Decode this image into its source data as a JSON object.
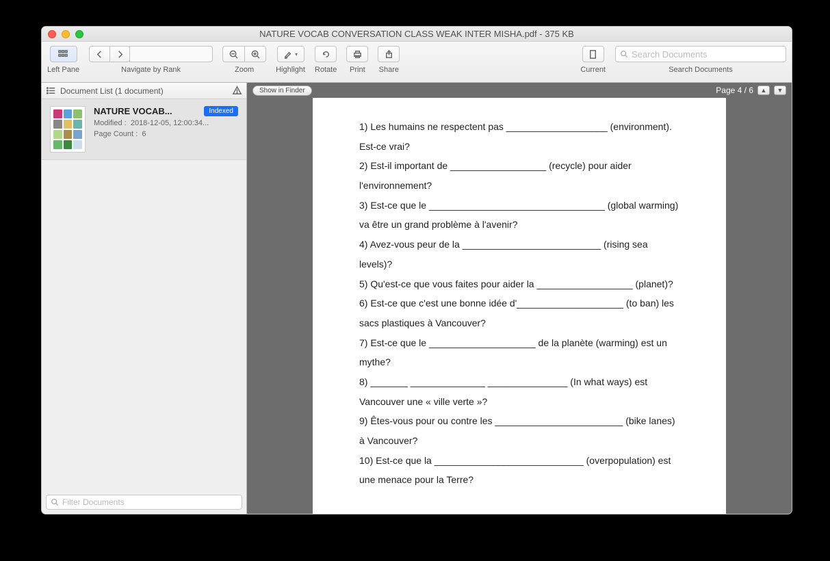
{
  "window": {
    "title": "NATURE VOCAB CONVERSATION CLASS WEAK INTER MISHA.pdf - 375 KB"
  },
  "toolbar": {
    "left_pane": "Left Pane",
    "navigate": "Navigate by Rank",
    "zoom": "Zoom",
    "highlight": "Highlight",
    "rotate": "Rotate",
    "print": "Print",
    "share": "Share",
    "current": "Current",
    "search_label": "Search Documents",
    "search_placeholder": "Search Documents"
  },
  "sidebar": {
    "header": "Document List (1 document)",
    "item": {
      "title": "NATURE VOCAB...",
      "badge": "Indexed",
      "modified_label": "Modified :",
      "modified_value": "2018-12-05, 12:00:34...",
      "page_count_label": "Page Count :",
      "page_count_value": "6"
    },
    "filter_placeholder": "Filter Documents"
  },
  "viewer": {
    "show_in_finder": "Show in Finder",
    "page_indicator": "Page 4 / 6"
  },
  "document": {
    "lines": [
      "1) Les humains ne respectent pas ___________________ (environment). Est-ce vrai?",
      "2) Est-il important de __________________ (recycle) pour aider l'environnement?",
      "3) Est-ce que le _________________________________ (global warming) va être un grand problème à l'avenir?",
      "4) Avez-vous peur de la __________________________ (rising sea levels)?",
      "5) Qu'est-ce que vous faites pour aider la __________________ (planet)?",
      "6) Est-ce que c'est une bonne idée d'____________________ (to ban) les sacs plastiques à Vancouver?",
      "7) Est-ce que le ____________________ de la planète (warming) est un mythe?",
      "8) _______ ______________ _______________ (In what ways) est Vancouver une « ville verte »?",
      "9) Êtes-vous pour ou contre les ________________________ (bike lanes) à Vancouver?",
      "10) Est-ce que la ____________________________ (overpopulation) est une menace pour la Terre?"
    ]
  }
}
